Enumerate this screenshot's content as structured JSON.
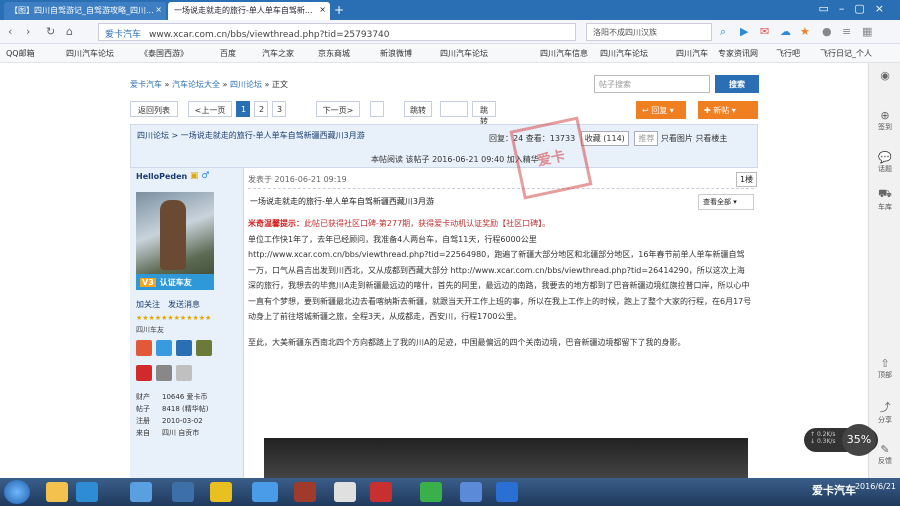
{
  "browser": {
    "tabs": [
      {
        "label": "【图】四川自驾游记_自驾游攻略_四川...",
        "active": false
      },
      {
        "label": "一场说走就走的旅行-单人单车自驾新...",
        "active": true
      }
    ],
    "url_site": "爱卡汽车",
    "url": "www.xcar.com.cn/bbs/viewthread.php?tid=25793740",
    "search_placeholder": "洛阳不成四川汉族",
    "bookmarks": [
      "QQ邮箱",
      "四川汽车论坛",
      "《泰国西游》",
      "百度",
      "汽车之家",
      "京东商城",
      "新浪微博",
      "四川汽车论坛",
      "四川汽车信息",
      "四川汽车论坛",
      "四川汽车",
      "专家资讯网",
      "飞行吧",
      "飞行日记_个人"
    ]
  },
  "forum": {
    "breadcrumb": [
      "爱卡汽车",
      "汽车论坛大全",
      "四川论坛",
      "正文"
    ],
    "search_placeholder": "帖子搜索",
    "search_label": "搜索",
    "pager": {
      "back": "返回列表",
      "prev": "<上一页",
      "pages": [
        "1",
        "2",
        "3"
      ],
      "next": "下一页>",
      "goto_label": "跳转",
      "page_label": "页",
      "goto_btn": "跳转"
    },
    "reply_label": "回复",
    "new_label": "新帖",
    "thread": {
      "forum_name": "四川论坛",
      "title": "一场说走就走的旅行-单人单车自驾新疆西藏川3月游",
      "replies_label": "回复：",
      "replies": "24",
      "views_label": "查看：",
      "views": "13733",
      "fav_label": "收藏 (114)",
      "share_label": "推荐",
      "only_image": "只看图片",
      "only_author": "只看楼主"
    },
    "post_bar": "本帖阅读 该帖子 2016-06-21 09:40 加入精华",
    "author": {
      "name": "HelloPeden",
      "badge": "认证车友",
      "links": [
        "加关注",
        "发送消息"
      ],
      "level": "四川车友",
      "info": [
        {
          "k": "财产",
          "v": "10646 爱卡币"
        },
        {
          "k": "帖子",
          "v": "8418 (精华帖)"
        },
        {
          "k": "注册",
          "v": "2010-03-02"
        },
        {
          "k": "来自",
          "v": "四川 自贡市"
        }
      ]
    },
    "post": {
      "time": "发表于 2016-06-21 09:19",
      "floor": "1楼",
      "title": "一场说走就走的旅行-单人单车自驾新疆西藏川3月游",
      "readall": "查看全部",
      "notice_red": "米奇温馨提示：",
      "notice_text": "此帖已获得社区口碑-第277期，获得爱卡动机认证奖励【社区口碑】。",
      "paras": [
        "单位工作快1年了，去年已经顾问，我准备4人两台车，自驾11天，行程6000公里",
        "http://www.xcar.com.cn/bbs/viewthread.php?tid=22564980，跑遍了新疆大部分地区和北疆部分地区，16年春节前单人单车新疆自驾一万，口气从昌吉出发到川西北，又从成都到西藏大部分 http://www.xcar.com.cn/bbs/viewthread.php?tid=26414290，所以这次上海深的旅行，我想去的毕竟川A走到新疆最远边的喀什，首先的阿里，最远边的南路，我要去的地方都到了巴音新疆边境红旗拉普口岸，所以心中一直有个梦想，要到新疆最北边去看喀纳斯去新疆，就跟当天开工作上班的事，所以在我上工作上的时候，跑上了整个大家的行程，在6月17号动身上了前往塔城新疆之旅，全程3天，从成都走，西安川，行程1700公里。",
        "至此，大美新疆东西南北四个方向都踏上了我的川A的足迹，中国最偏远的四个关南边境，巴音新疆边境都留下了我的身影。"
      ],
      "stamp": "爱卡"
    }
  },
  "sidebar": [
    {
      "icon": "plus",
      "label": "签到"
    },
    {
      "icon": "chat",
      "label": "话题"
    },
    {
      "icon": "car",
      "label": "车库"
    },
    {
      "icon": "arrow-up",
      "label": "顶部"
    },
    {
      "icon": "share",
      "label": "分享"
    },
    {
      "icon": "feedback",
      "label": "反馈"
    }
  ],
  "overlay": {
    "pct": "35",
    "up": "0.2K/s",
    "down": "0.3K/s"
  },
  "taskbar": {
    "brand": "爱卡汽车",
    "date": "2016/6/21"
  }
}
